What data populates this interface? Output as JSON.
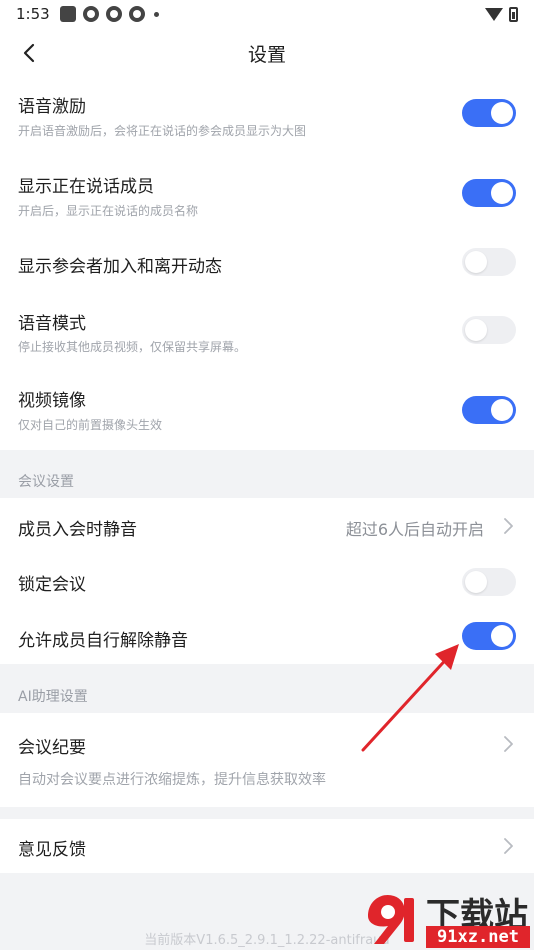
{
  "status_bar": {
    "time": "1:53"
  },
  "header": {
    "title": "设置"
  },
  "settings": [
    {
      "title": "语音激励",
      "subtitle": "开启语音激励后，会将正在说话的参会成员显示为大图",
      "on": true
    },
    {
      "title": "显示正在说话成员",
      "subtitle": "开启后，显示正在说话的成员名称",
      "on": true
    },
    {
      "title": "显示参会者加入和离开动态",
      "subtitle": "",
      "on": false
    },
    {
      "title": "语音模式",
      "subtitle": "停止接收其他成员视频，仅保留共享屏幕。",
      "on": false
    },
    {
      "title": "视频镜像",
      "subtitle": "仅对自己的前置摄像头生效",
      "on": true
    }
  ],
  "meeting_section": {
    "label": "会议设置",
    "mute_on_join": {
      "title": "成员入会时静音",
      "value": "超过6人后自动开启"
    },
    "lock_meeting": {
      "title": "锁定会议",
      "on": false
    },
    "allow_unmute": {
      "title": "允许成员自行解除静音",
      "on": true
    }
  },
  "ai_section": {
    "label": "AI助理设置",
    "summary": {
      "title": "会议纪要",
      "subtitle": "自动对会议要点进行浓缩提炼，提升信息获取效率"
    }
  },
  "feedback": {
    "title": "意见反馈"
  },
  "version": "当前版本V1.6.5_2.9.1_1.2.22-antifraud",
  "watermark": {
    "brand": "下载站",
    "domain": "91xz.net"
  },
  "colors": {
    "accent": "#3a6ff6",
    "toggle_off": "#eeeff2",
    "arrow": "#e0252b"
  }
}
